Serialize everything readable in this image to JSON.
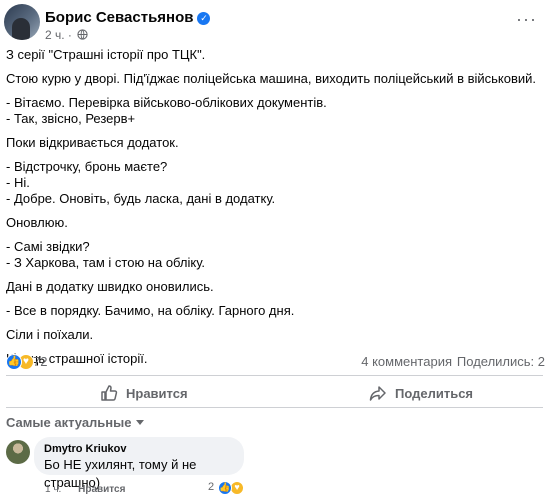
{
  "post": {
    "author": "Борис Севастьянов",
    "time": "2 ч.",
    "verified_icon": "verified-check-icon",
    "paragraphs": [
      "З серії \"Страшні історії про ТЦК\".",
      "Стою курю у дворі. Під'їджає поліцейська машина, виходить поліцейський в військовий.",
      "- Вітаємо. Перевірка військово-облікових документів.\n- Так, звісно, Резерв+",
      "Поки відкривається додаток.",
      "- Відстрочку, бронь маєте?\n- Ні.\n- Добре. Оновіть, будь ласка, дані в додатку.",
      "Оновлюю.",
      "- Самі звідки?\n- З Харкова, там і стою на обліку.",
      "Дані в додатку швидко оновились.",
      "- Все в порядку. Бачимо, на обліку. Гарного дня.",
      "Сіли і поїхали.",
      "Кінець страшної історії."
    ]
  },
  "stats": {
    "reactions_count": "72",
    "comments": "4 комментария",
    "shares": "Поделились: 2"
  },
  "actions": {
    "like": "Нравится",
    "share": "Поделиться"
  },
  "comments_section": {
    "filter": "Самые актуальные",
    "comments": [
      {
        "author": "Dmytro Kriukov",
        "text": "Бо НЕ ухилянт, тому й не страшно)",
        "time": "1 ч.",
        "like_label": "Нравится",
        "reactions_count": "2"
      }
    ]
  },
  "colors": {
    "accent": "#1877f2",
    "secondary_text": "#65676b",
    "bubble": "#f0f2f5"
  }
}
